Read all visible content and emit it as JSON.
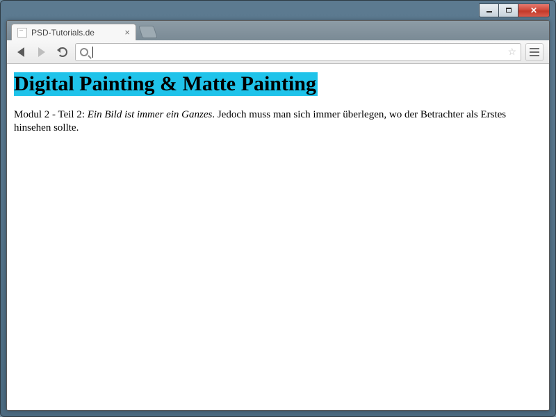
{
  "window": {
    "controls": {
      "minimize": "–",
      "maximize": "▢",
      "close": "✕"
    }
  },
  "tab": {
    "title": "PSD-Tutorials.de",
    "close_glyph": "×"
  },
  "toolbar": {
    "url_value": "",
    "url_placeholder": ""
  },
  "page": {
    "heading": "Digital Painting & Matte Painting",
    "para_prefix": "Modul 2 - Teil 2: ",
    "para_italic": "Ein Bild ist immer ein Ganzes",
    "para_rest": ". Jedoch muss man sich immer überlegen, wo der Betrachter als Erstes hinsehen sollte."
  }
}
